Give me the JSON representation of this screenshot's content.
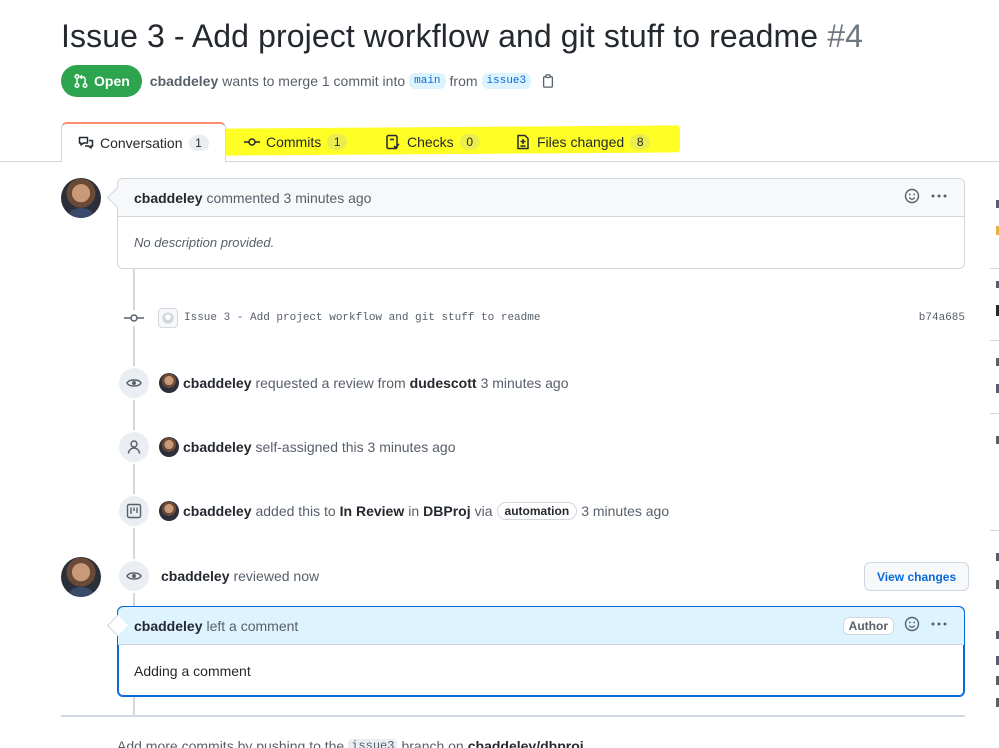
{
  "title": {
    "text": "Issue 3 - Add project workflow and git stuff to readme",
    "number": "#4"
  },
  "meta": {
    "state": "Open",
    "author": "cbaddeley",
    "action": "wants to merge 1 commit into",
    "base_branch": "main",
    "from_word": "from",
    "head_branch": "issue3"
  },
  "tabs": [
    {
      "label": "Conversation",
      "count": "1"
    },
    {
      "label": "Commits",
      "count": "1"
    },
    {
      "label": "Checks",
      "count": "0"
    },
    {
      "label": "Files changed",
      "count": "8"
    }
  ],
  "first_comment": {
    "author": "cbaddeley",
    "action": "commented 3 minutes ago",
    "body": "No description provided."
  },
  "commit": {
    "message": "Issue 3 - Add project workflow and git stuff to readme",
    "sha": "b74a685"
  },
  "events": {
    "review_request": {
      "actor": "cbaddeley",
      "text": "requested a review from",
      "reviewer": "dudescott",
      "time": "3 minutes ago"
    },
    "self_assign": {
      "actor": "cbaddeley",
      "text": "self-assigned this 3 minutes ago"
    },
    "project": {
      "actor": "cbaddeley",
      "text": "added this to",
      "column": "In Review",
      "in_word": "in",
      "project": "DBProj",
      "via_word": "via",
      "label": "automation",
      "time": "3 minutes ago"
    },
    "reviewed": {
      "actor": "cbaddeley",
      "text": "reviewed now",
      "button": "View changes"
    }
  },
  "review_comment": {
    "author": "cbaddeley",
    "action": "left a comment",
    "badge": "Author",
    "body": "Adding a comment"
  },
  "footer": {
    "pre": "Add more commits by pushing to the",
    "branch": "issue3",
    "mid": "branch on",
    "repo": "cbaddeley/dbproj."
  },
  "colors": {
    "open_green": "#2da44e",
    "link_blue": "#0969da",
    "highlight": "#ffff00",
    "tab_accent": "#fd8c73"
  }
}
